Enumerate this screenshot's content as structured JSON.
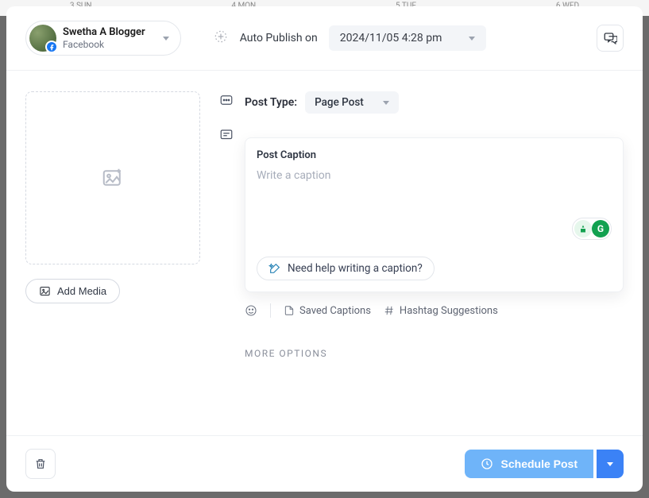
{
  "calendar": {
    "days": [
      "3 SUN",
      "4 MON",
      "5 TUE",
      "6 WED"
    ]
  },
  "account": {
    "name": "Swetha A Blogger",
    "network": "Facebook"
  },
  "publish": {
    "label": "Auto Publish on",
    "datetime": "2024/11/05 4:28 pm"
  },
  "post_type": {
    "label": "Post Type:",
    "selected": "Page Post"
  },
  "caption": {
    "title": "Post Caption",
    "placeholder": "Write a caption",
    "help": "Need help writing a caption?"
  },
  "tools": {
    "saved": "Saved Captions",
    "hashtag": "Hashtag Suggestions"
  },
  "media": {
    "add": "Add Media"
  },
  "sections": {
    "more": "MORE OPTIONS"
  },
  "footer": {
    "schedule": "Schedule Post"
  }
}
